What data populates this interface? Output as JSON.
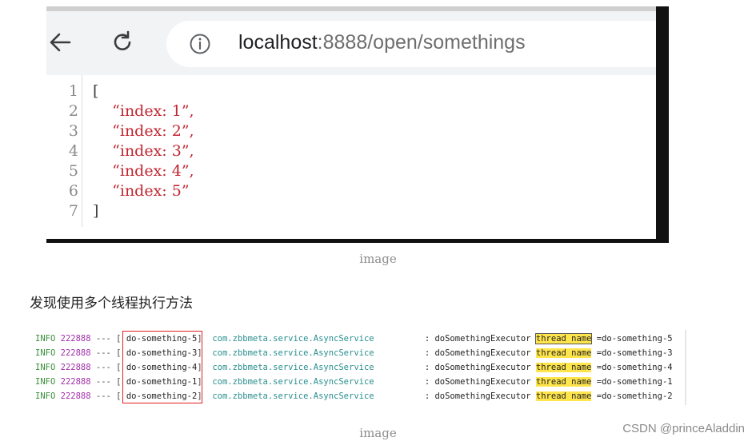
{
  "browser": {
    "url_host": "localhost",
    "url_rest": ":8888/open/somethings",
    "icons": [
      "back-arrow-icon",
      "reload-icon",
      "info-icon"
    ]
  },
  "json_view": {
    "line_numbers": [
      "1",
      "2",
      "3",
      "4",
      "5",
      "6",
      "7"
    ],
    "lines": [
      {
        "text": "[",
        "type": "bracket"
      },
      {
        "text": "    “index: 1”,",
        "type": "string"
      },
      {
        "text": "    “index: 2”,",
        "type": "string"
      },
      {
        "text": "    “index: 3”,",
        "type": "string"
      },
      {
        "text": "    “index: 4”,",
        "type": "string"
      },
      {
        "text": "    “index: 5”",
        "type": "string"
      },
      {
        "text": "]",
        "type": "bracket"
      }
    ]
  },
  "captions": {
    "first": "image",
    "second": "image"
  },
  "paragraph": "发现使用多个线程执行方法",
  "log": {
    "rows": [
      {
        "level": "INFO",
        "pid": "222888",
        "sep": " --- ",
        "thread": "do-something-5",
        "class": "com.zbbmeta.service.AsyncService",
        "msg": ": doSomethingExecutor ",
        "hl": "thread name",
        "value": " =do-something-5"
      },
      {
        "level": "INFO",
        "pid": "222888",
        "sep": " --- ",
        "thread": "do-something-3",
        "class": "com.zbbmeta.service.AsyncService",
        "msg": ": doSomethingExecutor ",
        "hl": "thread name",
        "value": " =do-something-3"
      },
      {
        "level": "INFO",
        "pid": "222888",
        "sep": " --- ",
        "thread": "do-something-4",
        "class": "com.zbbmeta.service.AsyncService",
        "msg": ": doSomethingExecutor ",
        "hl": "thread name",
        "value": " =do-something-4"
      },
      {
        "level": "INFO",
        "pid": "222888",
        "sep": " --- ",
        "thread": "do-something-1",
        "class": "com.zbbmeta.service.AsyncService",
        "msg": ": doSomethingExecutor ",
        "hl": "thread name",
        "value": " =do-something-1"
      },
      {
        "level": "INFO",
        "pid": "222888",
        "sep": " --- ",
        "thread": "do-something-2",
        "class": "com.zbbmeta.service.AsyncService",
        "msg": ": doSomethingExecutor ",
        "hl": "thread name",
        "value": " =do-something-2"
      }
    ],
    "colors": {
      "level": "#3c8f3c",
      "pid": "#a02ea8",
      "class": "#2a8e8e",
      "highlight": "#ffe54c",
      "box": "#e02020"
    }
  },
  "watermark": "CSDN @princeAladdin"
}
